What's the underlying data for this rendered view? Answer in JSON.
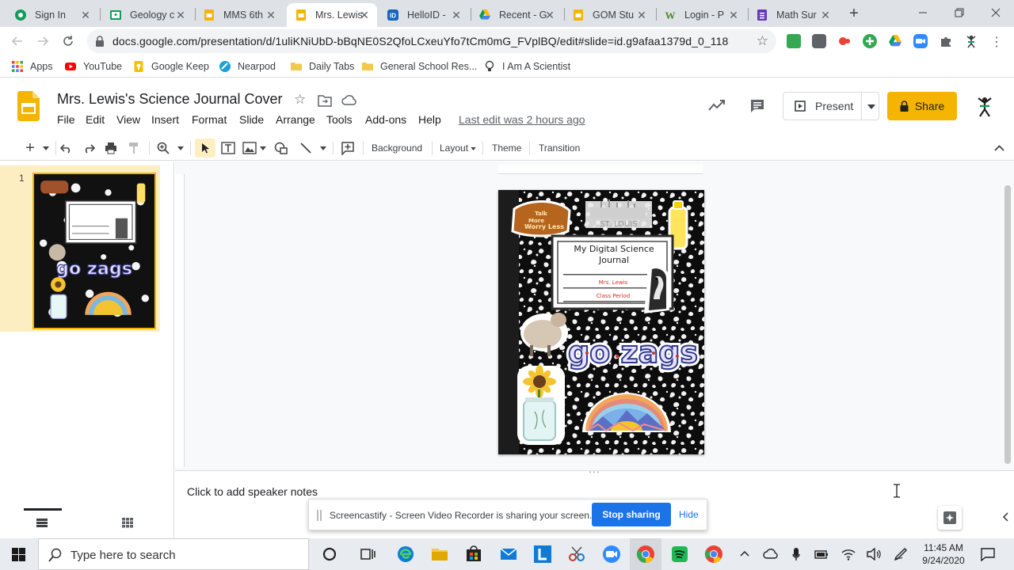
{
  "browser": {
    "tabs": [
      {
        "title": "Sign In",
        "icon": "sign-in-favicon"
      },
      {
        "title": "Geology c",
        "icon": "google-classroom-favicon"
      },
      {
        "title": "MMS 6th",
        "icon": "google-slides-favicon"
      },
      {
        "title": "Mrs. Lewis",
        "icon": "google-slides-favicon",
        "active": true
      },
      {
        "title": "HelloID -",
        "icon": "helloid-favicon"
      },
      {
        "title": "Recent - G",
        "icon": "google-drive-favicon"
      },
      {
        "title": "GOM Stu",
        "icon": "google-slides-favicon"
      },
      {
        "title": "Login - P",
        "icon": "wixie-favicon"
      },
      {
        "title": "Math Sur",
        "icon": "forms-favicon"
      }
    ],
    "new_tab_label": "+",
    "url": "docs.google.com/presentation/d/1uliKNiUbD-bBqNE0S2QfoLCxeuYfo7tCm0mG_FVplBQ/edit#slide=id.g9afaa1379d_0_118",
    "bookmarks": [
      {
        "label": "Apps",
        "icon": "apps-grid-icon"
      },
      {
        "label": "YouTube",
        "icon": "youtube-icon"
      },
      {
        "label": "Google Keep",
        "icon": "google-keep-icon"
      },
      {
        "label": "Nearpod",
        "icon": "nearpod-icon"
      },
      {
        "label": "Daily Tabs",
        "icon": "folder-icon"
      },
      {
        "label": "General School Res...",
        "icon": "folder-icon"
      },
      {
        "label": "I Am A Scientist",
        "icon": "lightbulb-icon"
      }
    ]
  },
  "slides": {
    "doc_title": "Mrs. Lewis's Science Journal Cover",
    "menus": [
      "File",
      "Edit",
      "View",
      "Insert",
      "Format",
      "Slide",
      "Arrange",
      "Tools",
      "Add-ons",
      "Help"
    ],
    "last_edit": "Last edit was 2 hours ago",
    "present_label": "Present",
    "share_label": "Share",
    "toolbar": {
      "background": "Background",
      "layout": "Layout",
      "theme": "Theme",
      "transition": "Transition"
    },
    "slide_number": "1",
    "speaker_notes_placeholder": "Click to add speaker notes",
    "slide_content": {
      "badge_line1": "Talk",
      "badge_line2": "More",
      "badge_line3": "Worry Less",
      "city": "ST. LOUIS",
      "journal_title_line1": "My Digital Science",
      "journal_title_line2": "Journal",
      "name_line": "Mrs. Lewis",
      "period_line": "Class Period",
      "sticker_text": "go zags"
    }
  },
  "screencastify": {
    "message": "Screencastify - Screen Video Recorder is sharing your screen.",
    "stop_label": "Stop sharing",
    "hide_label": "Hide"
  },
  "taskbar": {
    "search_placeholder": "Type here to search",
    "time": "11:45 AM",
    "date": "9/24/2020"
  },
  "colors": {
    "slides_yellow": "#f4b400",
    "chrome_blue": "#1a73e8",
    "tab_strip": "#dee1e6"
  }
}
